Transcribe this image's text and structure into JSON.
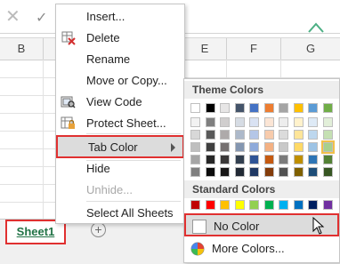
{
  "formula_bar": {
    "cancel_glyph": "✕",
    "enter_glyph": "✓"
  },
  "columns": [
    "B",
    "E",
    "F",
    "G"
  ],
  "sheet_tab": {
    "label": "Sheet1"
  },
  "add_sheet": {
    "glyph": "⊕"
  },
  "context_menu": {
    "items": [
      {
        "label": "Insert...",
        "icon": "insert-icon"
      },
      {
        "label": "Delete",
        "icon": "delete-icon"
      },
      {
        "label": "Rename",
        "icon": ""
      },
      {
        "label": "Move or Copy...",
        "icon": ""
      },
      {
        "label": "View Code",
        "icon": "view-code-icon"
      },
      {
        "label": "Protect Sheet...",
        "icon": "protect-sheet-icon"
      },
      {
        "label": "Tab Color",
        "icon": "",
        "selected": true
      },
      {
        "label": "Hide",
        "icon": ""
      },
      {
        "label": "Unhide...",
        "icon": "",
        "disabled": true
      },
      {
        "label": "Select All Sheets",
        "icon": ""
      }
    ]
  },
  "color_panel": {
    "theme_heading": "Theme Colors",
    "standard_heading": "Standard Colors",
    "theme_colors": [
      [
        "#ffffff",
        "#000000",
        "#e7e6e6",
        "#44546a",
        "#4472c4",
        "#ed7d31",
        "#a5a5a5",
        "#ffc000",
        "#5b9bd5",
        "#70ad47"
      ],
      [
        "#f2f2f2",
        "#7f7f7f",
        "#d0cece",
        "#d6dce4",
        "#d9e2f3",
        "#fbe5d5",
        "#ededed",
        "#fff2cc",
        "#deeaf6",
        "#e2efd9"
      ],
      [
        "#d8d8d8",
        "#595959",
        "#aeaaaa",
        "#adb9ca",
        "#b4c6e7",
        "#f7cbac",
        "#dbdbdb",
        "#fee599",
        "#bdd7ee",
        "#c5e0b3"
      ],
      [
        "#bfbfbf",
        "#3f3f3f",
        "#757070",
        "#8496b0",
        "#8eaadb",
        "#f4b183",
        "#c9c9c9",
        "#ffd965",
        "#9cc3e5",
        "#a8d08d"
      ],
      [
        "#a5a5a5",
        "#262626",
        "#3a3838",
        "#323f4f",
        "#2f5496",
        "#c55a11",
        "#7b7b7b",
        "#bf8f00",
        "#2e75b5",
        "#538135"
      ],
      [
        "#7f7f7f",
        "#0c0c0c",
        "#171616",
        "#222a35",
        "#1f3864",
        "#833c0b",
        "#525252",
        "#7f6000",
        "#1e4e79",
        "#375623"
      ]
    ],
    "standard_colors": [
      "#c00000",
      "#ff0000",
      "#ffc000",
      "#ffff00",
      "#92d050",
      "#00b050",
      "#00b0f0",
      "#0070c0",
      "#002060",
      "#7030a0"
    ],
    "no_color_label": "No Color",
    "more_colors_label": "More Colors..."
  }
}
